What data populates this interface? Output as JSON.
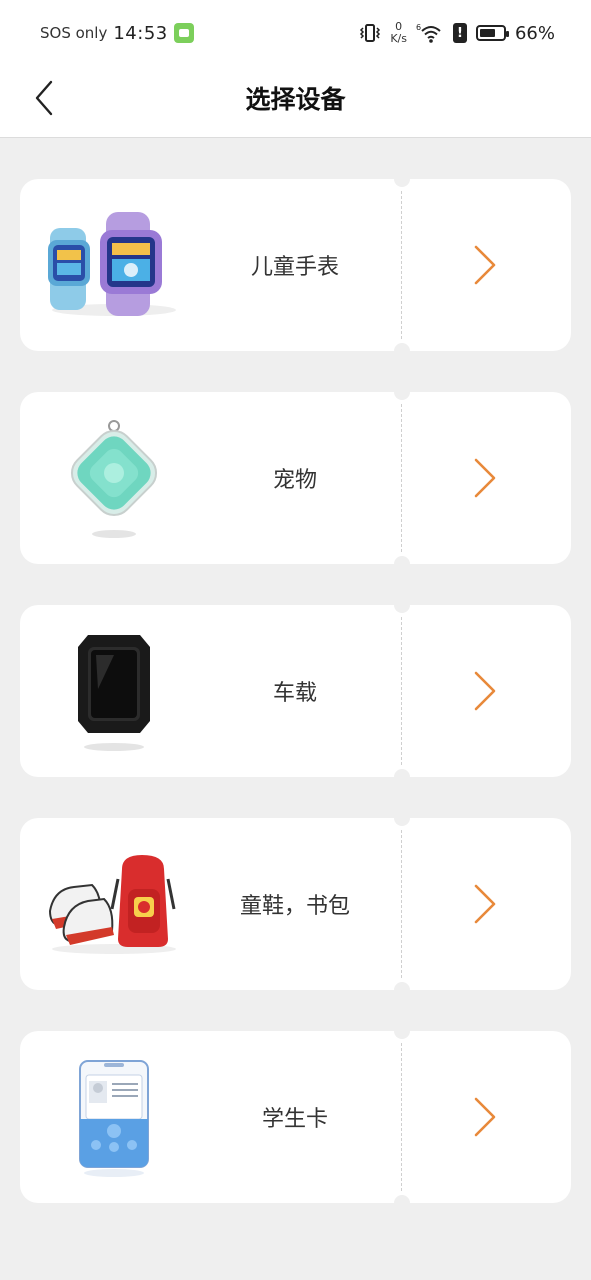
{
  "status_bar": {
    "carrier": "SOS only",
    "time": "14:53",
    "net_speed_value": "0",
    "net_speed_unit": "K/s",
    "signal_label": "6",
    "battery_level": 0.66,
    "battery_percent": "66%"
  },
  "header": {
    "title": "选择设备",
    "back_icon": "chevron-left-icon"
  },
  "colors": {
    "accent": "#e8893a",
    "background": "#efefef",
    "card": "#ffffff"
  },
  "devices": [
    {
      "label": "儿童手表",
      "icon": "kids-watch-image"
    },
    {
      "label": "宠物",
      "icon": "pet-tracker-image"
    },
    {
      "label": "车载",
      "icon": "car-tracker-image"
    },
    {
      "label": "童鞋，书包",
      "icon": "shoes-backpack-image"
    },
    {
      "label": "学生卡",
      "icon": "student-card-image"
    }
  ]
}
